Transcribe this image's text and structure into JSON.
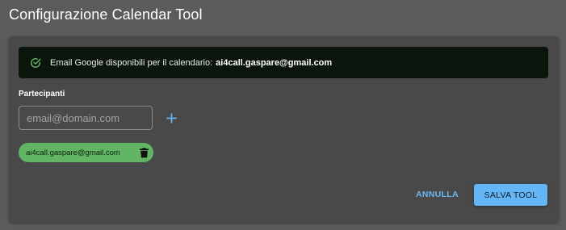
{
  "page": {
    "title": "Configurazione Calendar Tool"
  },
  "alert": {
    "icon": "check-circle-icon",
    "text": "Email Google disponibili per il calendario:",
    "email": "ai4call.gaspare@gmail.com",
    "color": "#66bb6a"
  },
  "participants": {
    "label": "Partecipanti",
    "input_value": "",
    "input_placeholder": "email@domain.com",
    "add_icon": "plus-icon",
    "chips": [
      {
        "label": "ai4call.gaspare@gmail.com",
        "delete_icon": "trash-icon"
      }
    ]
  },
  "actions": {
    "cancel_label": "ANNULLA",
    "save_label": "SALVA TOOL",
    "accent_color": "#64b6f6"
  }
}
